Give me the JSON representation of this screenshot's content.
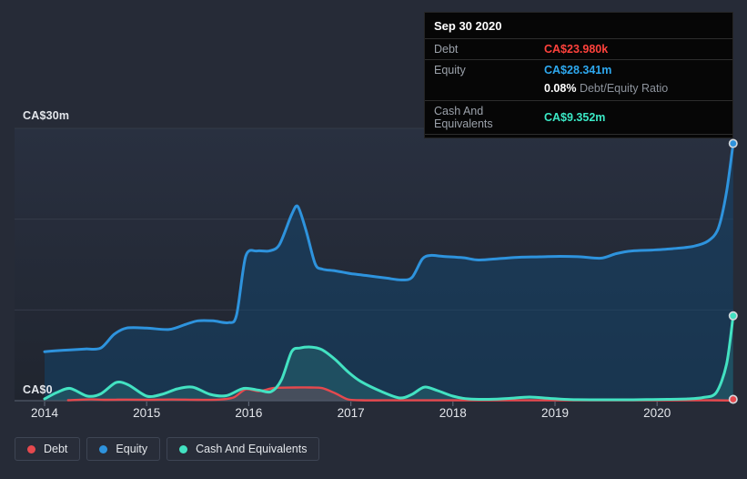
{
  "colors": {
    "background": "#262b37",
    "debt": "#ff423c",
    "equity": "#2ea9f0",
    "cash": "#3be9c6",
    "axis_text": "#e3e6eb",
    "grid": "#343b49",
    "axis_line": "#515968"
  },
  "tooltip": {
    "date": "Sep 30 2020",
    "debt_label": "Debt",
    "debt_value": "CA$23.980k",
    "equity_label": "Equity",
    "equity_value": "CA$28.341m",
    "ratio_value": "0.08%",
    "ratio_label": "Debt/Equity Ratio",
    "cash_label": "Cash And Equivalents",
    "cash_value": "CA$9.352m"
  },
  "legend": {
    "items": [
      {
        "label": "Debt",
        "color": "#e5494e"
      },
      {
        "label": "Equity",
        "color": "#2e93dd"
      },
      {
        "label": "Cash And Equivalents",
        "color": "#43e2c2"
      }
    ]
  },
  "chart_data": {
    "type": "area",
    "title": "Debt, Equity and Cash And Equivalents history (CA$m)",
    "x_unit": "year",
    "x_range": [
      2014.0,
      2020.745
    ],
    "x_ticks": [
      "2014",
      "2015",
      "2016",
      "2017",
      "2018",
      "2019",
      "2020"
    ],
    "ylim": [
      0,
      30
    ],
    "y_gridlines": [
      0,
      10,
      20,
      30
    ],
    "y_label_top": "CA$30m",
    "y_label_zero": "CA$0",
    "grid": true,
    "legend_position": "bottom-left",
    "series": [
      {
        "name": "Equity",
        "color": "#2e93dd",
        "fill": "rgba(18,70,112,0.50)",
        "points": [
          [
            2014.0,
            5.4
          ],
          [
            2014.1,
            5.5
          ],
          [
            2014.25,
            5.6
          ],
          [
            2014.4,
            5.7
          ],
          [
            2014.55,
            5.8
          ],
          [
            2014.68,
            7.3
          ],
          [
            2014.8,
            8.0
          ],
          [
            2015.0,
            8.0
          ],
          [
            2015.22,
            7.85
          ],
          [
            2015.38,
            8.4
          ],
          [
            2015.5,
            8.8
          ],
          [
            2015.65,
            8.8
          ],
          [
            2015.8,
            8.6
          ],
          [
            2015.88,
            9.4
          ],
          [
            2015.97,
            15.9
          ],
          [
            2016.08,
            16.5
          ],
          [
            2016.2,
            16.5
          ],
          [
            2016.3,
            17.2
          ],
          [
            2016.42,
            20.5
          ],
          [
            2016.48,
            21.4
          ],
          [
            2016.56,
            18.8
          ],
          [
            2016.65,
            15.1
          ],
          [
            2016.72,
            14.5
          ],
          [
            2016.85,
            14.3
          ],
          [
            2017.0,
            14.0
          ],
          [
            2017.15,
            13.8
          ],
          [
            2017.35,
            13.5
          ],
          [
            2017.5,
            13.3
          ],
          [
            2017.6,
            13.6
          ],
          [
            2017.7,
            15.6
          ],
          [
            2017.78,
            16.0
          ],
          [
            2017.9,
            15.9
          ],
          [
            2018.1,
            15.75
          ],
          [
            2018.25,
            15.5
          ],
          [
            2018.45,
            15.65
          ],
          [
            2018.65,
            15.8
          ],
          [
            2018.85,
            15.85
          ],
          [
            2019.05,
            15.9
          ],
          [
            2019.25,
            15.85
          ],
          [
            2019.45,
            15.7
          ],
          [
            2019.6,
            16.2
          ],
          [
            2019.75,
            16.5
          ],
          [
            2019.95,
            16.6
          ],
          [
            2020.15,
            16.75
          ],
          [
            2020.35,
            17.0
          ],
          [
            2020.5,
            17.6
          ],
          [
            2020.6,
            19.0
          ],
          [
            2020.68,
            23.0
          ],
          [
            2020.745,
            28.341
          ]
        ]
      },
      {
        "name": "Cash And Equivalents",
        "color": "#43e2c2",
        "fill": "rgba(67,226,194,0.15)",
        "points": [
          [
            2014.0,
            0.2
          ],
          [
            2014.12,
            0.9
          ],
          [
            2014.25,
            1.35
          ],
          [
            2014.42,
            0.5
          ],
          [
            2014.55,
            0.75
          ],
          [
            2014.7,
            2.0
          ],
          [
            2014.82,
            1.75
          ],
          [
            2015.0,
            0.5
          ],
          [
            2015.15,
            0.7
          ],
          [
            2015.3,
            1.3
          ],
          [
            2015.45,
            1.5
          ],
          [
            2015.62,
            0.7
          ],
          [
            2015.78,
            0.55
          ],
          [
            2015.95,
            1.35
          ],
          [
            2016.1,
            1.15
          ],
          [
            2016.22,
            1.0
          ],
          [
            2016.32,
            2.3
          ],
          [
            2016.42,
            5.4
          ],
          [
            2016.5,
            5.8
          ],
          [
            2016.62,
            5.9
          ],
          [
            2016.72,
            5.6
          ],
          [
            2016.85,
            4.5
          ],
          [
            2016.98,
            3.1
          ],
          [
            2017.1,
            2.1
          ],
          [
            2017.3,
            1.0
          ],
          [
            2017.48,
            0.3
          ],
          [
            2017.6,
            0.7
          ],
          [
            2017.72,
            1.5
          ],
          [
            2017.85,
            1.1
          ],
          [
            2018.0,
            0.5
          ],
          [
            2018.15,
            0.2
          ],
          [
            2018.35,
            0.15
          ],
          [
            2018.55,
            0.25
          ],
          [
            2018.75,
            0.4
          ],
          [
            2018.95,
            0.25
          ],
          [
            2019.15,
            0.12
          ],
          [
            2019.4,
            0.1
          ],
          [
            2019.65,
            0.1
          ],
          [
            2019.9,
            0.12
          ],
          [
            2020.1,
            0.15
          ],
          [
            2020.3,
            0.2
          ],
          [
            2020.45,
            0.35
          ],
          [
            2020.58,
            0.9
          ],
          [
            2020.68,
            4.0
          ],
          [
            2020.745,
            9.352
          ]
        ]
      },
      {
        "name": "Debt",
        "color": "#e5494e",
        "fill": "rgba(229,73,78,0.20)",
        "points": [
          [
            2014.23,
            0.05
          ],
          [
            2014.45,
            0.14
          ],
          [
            2014.6,
            0.1
          ],
          [
            2014.8,
            0.12
          ],
          [
            2015.0,
            0.1
          ],
          [
            2015.25,
            0.13
          ],
          [
            2015.5,
            0.1
          ],
          [
            2015.7,
            0.12
          ],
          [
            2015.85,
            0.35
          ],
          [
            2015.97,
            1.25
          ],
          [
            2016.1,
            1.05
          ],
          [
            2016.25,
            1.4
          ],
          [
            2016.45,
            1.45
          ],
          [
            2016.6,
            1.45
          ],
          [
            2016.72,
            1.38
          ],
          [
            2016.85,
            0.8
          ],
          [
            2016.97,
            0.15
          ],
          [
            2017.1,
            0.05
          ],
          [
            2017.4,
            0.04
          ],
          [
            2017.8,
            0.04
          ],
          [
            2018.2,
            0.04
          ],
          [
            2018.6,
            0.04
          ],
          [
            2019.0,
            0.04
          ],
          [
            2019.4,
            0.04
          ],
          [
            2019.8,
            0.04
          ],
          [
            2020.2,
            0.04
          ],
          [
            2020.5,
            0.04
          ],
          [
            2020.745,
            0.024
          ]
        ]
      }
    ]
  }
}
